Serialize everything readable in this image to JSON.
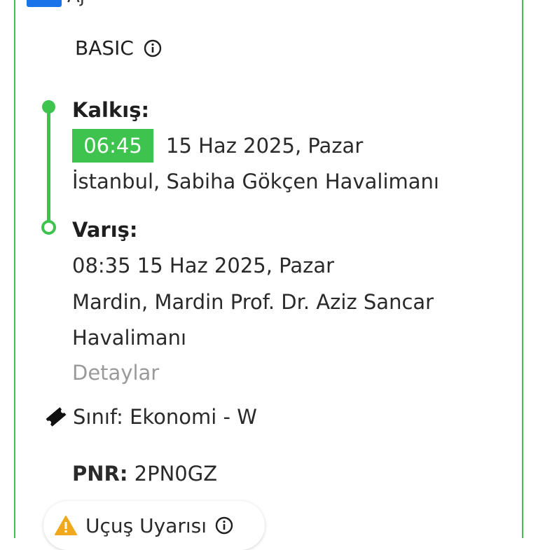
{
  "header": {
    "airline_partial": "Aj"
  },
  "fare": {
    "label": "BASIC"
  },
  "departure": {
    "title": "Kalkış:",
    "time": "06:45",
    "date": "15 Haz 2025, Pazar",
    "airport": "İstanbul, Sabiha Gökçen Havalimanı"
  },
  "arrival": {
    "title": "Varış:",
    "time_date": "08:35  15 Haz 2025, Pazar",
    "airport_line1": "Mardin, Mardin Prof. Dr. Aziz Sancar",
    "airport_line2": "Havalimanı"
  },
  "details_link": "Detaylar",
  "class_info": {
    "text": "Sınıf: Ekonomi - W"
  },
  "pnr": {
    "label": "PNR:",
    "value": "2PN0GZ"
  },
  "alert": {
    "label": "Uçuş Uyarısı"
  },
  "colors": {
    "accent": "#3ec34f",
    "brand": "#1a73e8",
    "muted": "#9a9a9a",
    "warning": "#f0a81c"
  }
}
